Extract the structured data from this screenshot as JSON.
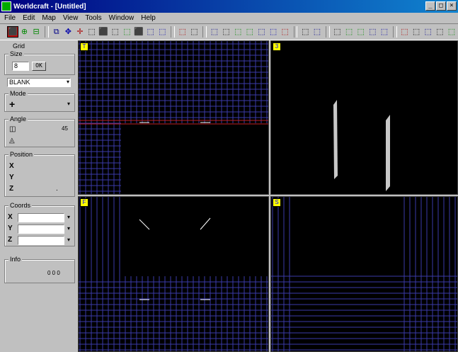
{
  "window": {
    "title": "Worldcraft - [Untitled]",
    "buttons": {
      "minimize": "_",
      "maximize": "□",
      "close": "×"
    }
  },
  "menu": [
    "File",
    "Edit",
    "Map",
    "View",
    "Tools",
    "Window",
    "Help"
  ],
  "toolbar": {
    "tools": [
      "⬛",
      "⊕",
      "⊟",
      "⧉",
      "✥",
      "✛",
      "⬚",
      "⬛",
      "⬚",
      "⬚",
      "⬛",
      "⬚",
      "⬚",
      "⬚",
      "⬚",
      "⬚",
      "⬚",
      "⬚",
      "⬚",
      "⬚",
      "⬚",
      "⬚",
      "⬚",
      "⬚",
      "⬚",
      "⬚",
      "⬚",
      "⬚",
      "⬚",
      "⬚",
      "⬚",
      "⬚",
      "⬚",
      "⬚"
    ]
  },
  "sidebar": {
    "top_label": "Grid",
    "grid_group": {
      "label": "Size",
      "value": "8",
      "unit": "OK"
    },
    "texture_select": "BLANK",
    "mode_group": {
      "label": "Mode",
      "value": "+"
    },
    "angle_group": {
      "label": "Angle",
      "value": "45",
      "icon": "angle-icon"
    },
    "position_group": {
      "label": "Position",
      "x_label": "X",
      "y_label": "Y",
      "z_label": "Z",
      "z_value": "."
    },
    "coords_group": {
      "label": "Coords",
      "x_label": "X",
      "y_label": "Y",
      "z_label": "Z"
    },
    "info_group": {
      "label": "Info",
      "value": "0 0 0"
    }
  },
  "viewports": {
    "top_left": {
      "name": "top",
      "icon_text": "T"
    },
    "top_right": {
      "name": "3d",
      "icon_text": "3"
    },
    "bottom_left": {
      "name": "front",
      "icon_text": "F"
    },
    "bottom_right": {
      "name": "side",
      "icon_text": "S"
    }
  },
  "colors": {
    "grid": "#3a3aa8",
    "bg": "#000000",
    "highlight_line": "#c02020",
    "brush": "#c8c8c8"
  }
}
